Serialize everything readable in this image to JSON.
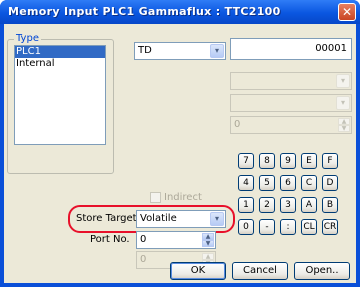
{
  "window": {
    "title": "Memory Input  PLC1 Gammaflux : TTC2100",
    "close_glyph": "✕"
  },
  "type_group": {
    "label": "Type",
    "items": [
      {
        "label": "PLC1",
        "selected": true
      },
      {
        "label": "Internal",
        "selected": false
      }
    ]
  },
  "device_combo": {
    "value": "TD"
  },
  "address_field": {
    "value": "00001"
  },
  "disabled_spin": {
    "value": "0"
  },
  "indirect_checkbox": {
    "label": "Indirect",
    "checked": false
  },
  "store_target": {
    "label": "Store Target",
    "value": "Volatile"
  },
  "port_no": {
    "label": "Port No.",
    "value": "0",
    "second_value": "0"
  },
  "keypad": {
    "row1": [
      "7",
      "8",
      "9",
      "E",
      "F"
    ],
    "row2": [
      "4",
      "5",
      "6",
      "C",
      "D"
    ],
    "row3": [
      "1",
      "2",
      "3",
      "A",
      "B"
    ],
    "row4": [
      "0",
      "-",
      ":",
      "CL",
      "CR"
    ]
  },
  "buttons": {
    "ok": "OK",
    "cancel": "Cancel",
    "open": "Open.."
  },
  "icons": {
    "dropdown": "▾",
    "spin_up": "▲",
    "spin_down": "▼"
  },
  "colors": {
    "title_bar": "#0a56e0",
    "highlight": "#e8102a",
    "selection": "#316ac5"
  }
}
